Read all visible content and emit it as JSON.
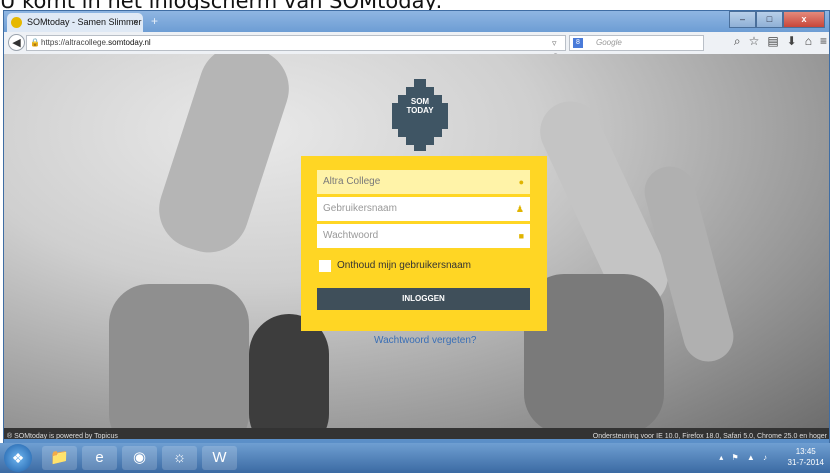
{
  "caption": "U komt in het inlogscherm van SOMtoday:",
  "browser": {
    "tab_title": "SOMtoday - Samen Slimmer ...",
    "tab_close": "×",
    "new_tab": "+",
    "url_host_prefix": "https://altracollege.",
    "url_host_domain": "somtoday.nl",
    "reload": "▿ C",
    "search_engine_badge": "8",
    "search_placeholder": "Google",
    "window_buttons": [
      "–",
      "□",
      "x"
    ],
    "nav_icons": [
      "search-icon",
      "star-icon",
      "bookmarks-icon",
      "download-icon",
      "home-icon",
      "menu-icon"
    ],
    "nav_icon_glyphs": [
      "⌕",
      "☆",
      "▤",
      "⬇",
      "⌂",
      "≡"
    ]
  },
  "logo": {
    "line1": "SOM",
    "line2": "TODAY",
    "color": "#3f5564"
  },
  "login": {
    "school_value": "Altra College",
    "username_placeholder": "Gebruikersnaam",
    "password_placeholder": "Wachtwoord",
    "remember_label": "Onthoud mijn gebruikersnaam",
    "button_label": "INLOGGEN",
    "forgot_link": "Wachtwoord vergeten?",
    "panel_color": "#ffd624",
    "button_color": "#3f4f5a"
  },
  "footer": {
    "left": "® SOMtoday is powered by Topicus",
    "right": "Ondersteuning voor IE 10.0, Firefox 18.0, Safari 5.0, Chrome 25.0 en hoger"
  },
  "taskbar": {
    "apps": [
      "explorer-icon",
      "ie-icon",
      "chrome-icon",
      "firefox-icon",
      "word-icon"
    ],
    "time": "13:45",
    "date": "31-7-2014"
  }
}
